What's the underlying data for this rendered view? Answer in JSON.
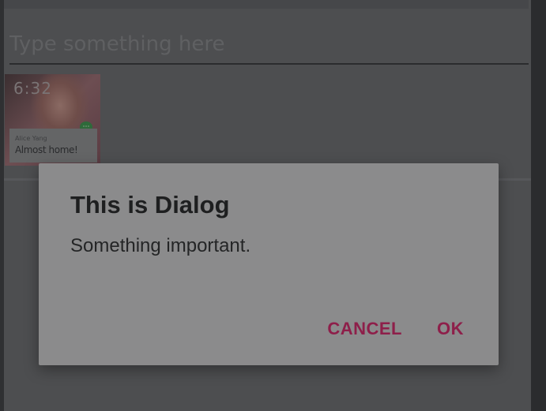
{
  "input": {
    "placeholder": "Type something here",
    "value": ""
  },
  "preview": {
    "time": "6:32",
    "sender": "Alice Yang",
    "message": "Almost home!",
    "icon": "hangouts-icon"
  },
  "dialog": {
    "title": "This is Dialog",
    "message": "Something important.",
    "cancel_label": "CANCEL",
    "ok_label": "OK",
    "button_color": "#8e1f4a"
  }
}
